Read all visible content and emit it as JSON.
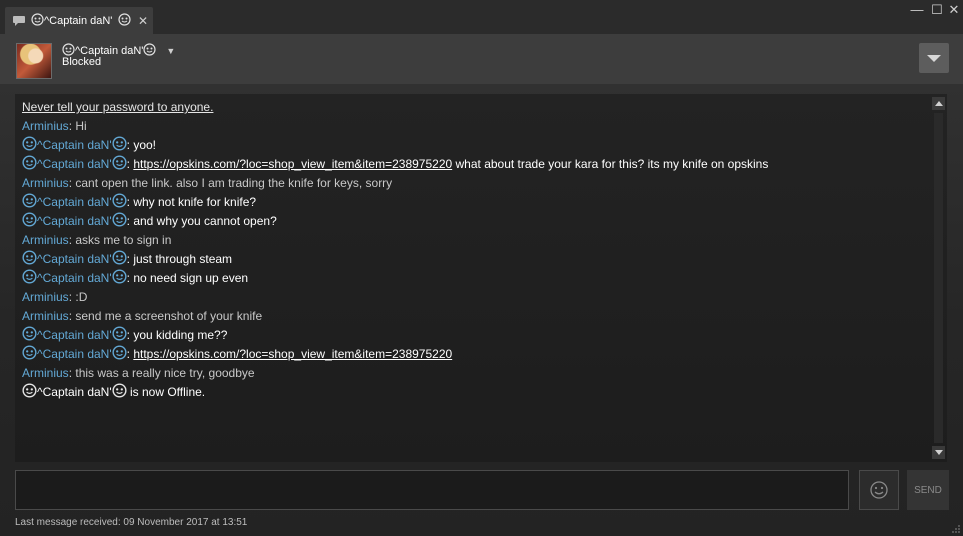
{
  "tab": {
    "title": "^Captain daN'"
  },
  "window_controls": {
    "minimize": "—",
    "maximize": "☐",
    "close": "✕"
  },
  "header": {
    "friend_name": "^Captain daN'",
    "friend_status": "Blocked"
  },
  "chat": {
    "notice": "Never tell your password to anyone.",
    "messages": [
      {
        "sender": "Arminius",
        "text": "Hi",
        "type": "me"
      },
      {
        "sender": "^Captain daN'",
        "text": "yoo!",
        "type": "friend"
      },
      {
        "sender": "^Captain daN'",
        "link": "https://opskins.com/?loc=shop_view_item&item=238975220",
        "text": " what about trade your kara for this? its my knife on opskins",
        "type": "friend"
      },
      {
        "sender": "Arminius",
        "text": "cant open the link. also I am trading the knife for keys, sorry",
        "type": "me"
      },
      {
        "sender": "^Captain daN'",
        "text": "why not knife for knife?",
        "type": "friend"
      },
      {
        "sender": "^Captain daN'",
        "text": "and why you cannot open?",
        "type": "friend"
      },
      {
        "sender": "Arminius",
        "text": "asks me to sign in",
        "type": "me"
      },
      {
        "sender": "^Captain daN'",
        "text": "just through steam",
        "type": "friend"
      },
      {
        "sender": "^Captain daN'",
        "text": "no need sign up even",
        "type": "friend"
      },
      {
        "sender": "Arminius",
        "text": ":D",
        "type": "me"
      },
      {
        "sender": "Arminius",
        "text": "send me a screenshot of your knife",
        "type": "me"
      },
      {
        "sender": "^Captain daN'",
        "text": "you kidding me??",
        "type": "friend"
      },
      {
        "sender": "^Captain daN'",
        "link": "https://opskins.com/?loc=shop_view_item&item=238975220",
        "text": "",
        "type": "friend"
      },
      {
        "sender": "Arminius",
        "text": "this was a really nice try, goodbye",
        "type": "me"
      }
    ],
    "offline_notice": {
      "name": "^Captain daN'",
      "text": " is now Offline."
    }
  },
  "input": {
    "send_label": "SEND"
  },
  "footer": {
    "last_message": "Last message received: 09 November 2017 at 13:51"
  },
  "colors": {
    "sender": "#63a9d6",
    "friend_text": "#ffffff",
    "my_text": "#c9c9c9"
  }
}
